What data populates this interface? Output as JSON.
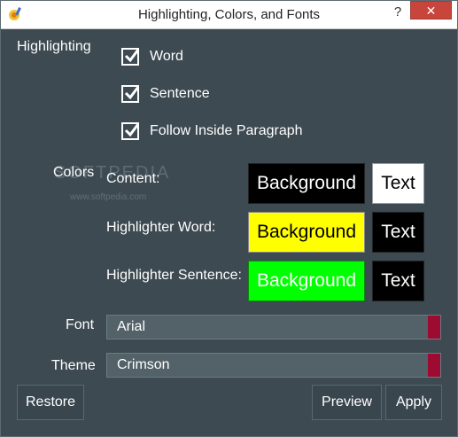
{
  "window": {
    "title": "Highlighting, Colors, and Fonts",
    "help": "?",
    "close": "✕"
  },
  "highlighting": {
    "label": "Highlighting",
    "options": [
      {
        "label": "Word",
        "checked": true
      },
      {
        "label": "Sentence",
        "checked": true
      },
      {
        "label": "Follow Inside Paragraph",
        "checked": true
      }
    ]
  },
  "colors": {
    "label": "Colors",
    "rows": [
      {
        "label": "Content:",
        "background_label": "Background",
        "text_label": "Text",
        "background_swatch": {
          "bg": "#000000",
          "fg": "#ffffff"
        },
        "text_swatch": {
          "bg": "#ffffff",
          "fg": "#000000"
        }
      },
      {
        "label": "Highlighter Word:",
        "background_label": "Background",
        "text_label": "Text",
        "background_swatch": {
          "bg": "#ffff00",
          "fg": "#000000"
        },
        "text_swatch": {
          "bg": "#000000",
          "fg": "#ffffff"
        }
      },
      {
        "label": "Highlighter Sentence:",
        "background_label": "Background",
        "text_label": "Text",
        "background_swatch": {
          "bg": "#00ff00",
          "fg": "#ffffff"
        },
        "text_swatch": {
          "bg": "#000000",
          "fg": "#ffffff"
        }
      }
    ]
  },
  "font": {
    "label": "Font",
    "value": "Arial"
  },
  "theme": {
    "label": "Theme",
    "value": "Crimson"
  },
  "buttons": {
    "restore": "Restore",
    "preview": "Preview",
    "apply": "Apply"
  },
  "watermark": {
    "text": "SOFTPEDIA",
    "url": "www.softpedia.com"
  },
  "theme_colors": {
    "panel": "#3d4a52",
    "accent": "#9e0b32"
  }
}
